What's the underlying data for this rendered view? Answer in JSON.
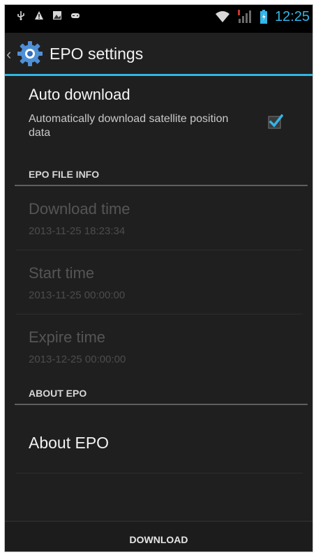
{
  "status_bar": {
    "clock": "12:25",
    "icons": [
      "usb-icon",
      "warning-icon",
      "image-notification-icon",
      "game-controller-icon",
      "wifi-icon",
      "signal-icon",
      "battery-icon"
    ]
  },
  "action_bar": {
    "title": "EPO settings",
    "icon": "gear-icon",
    "accent_color": "#33b5e5"
  },
  "auto_download": {
    "title": "Auto download",
    "summary": "Automatically download satellite position data",
    "checked": true
  },
  "epo_file_info": {
    "header": "EPO FILE INFO",
    "items": [
      {
        "title": "Download time",
        "value": "2013-11-25 18:23:34"
      },
      {
        "title": "Start time",
        "value": "2013-11-25 00:00:00"
      },
      {
        "title": "Expire time",
        "value": "2013-12-25 00:00:00"
      }
    ]
  },
  "about": {
    "header": "ABOUT EPO",
    "item_title": "About EPO"
  },
  "footer": {
    "download_label": "DOWNLOAD"
  }
}
